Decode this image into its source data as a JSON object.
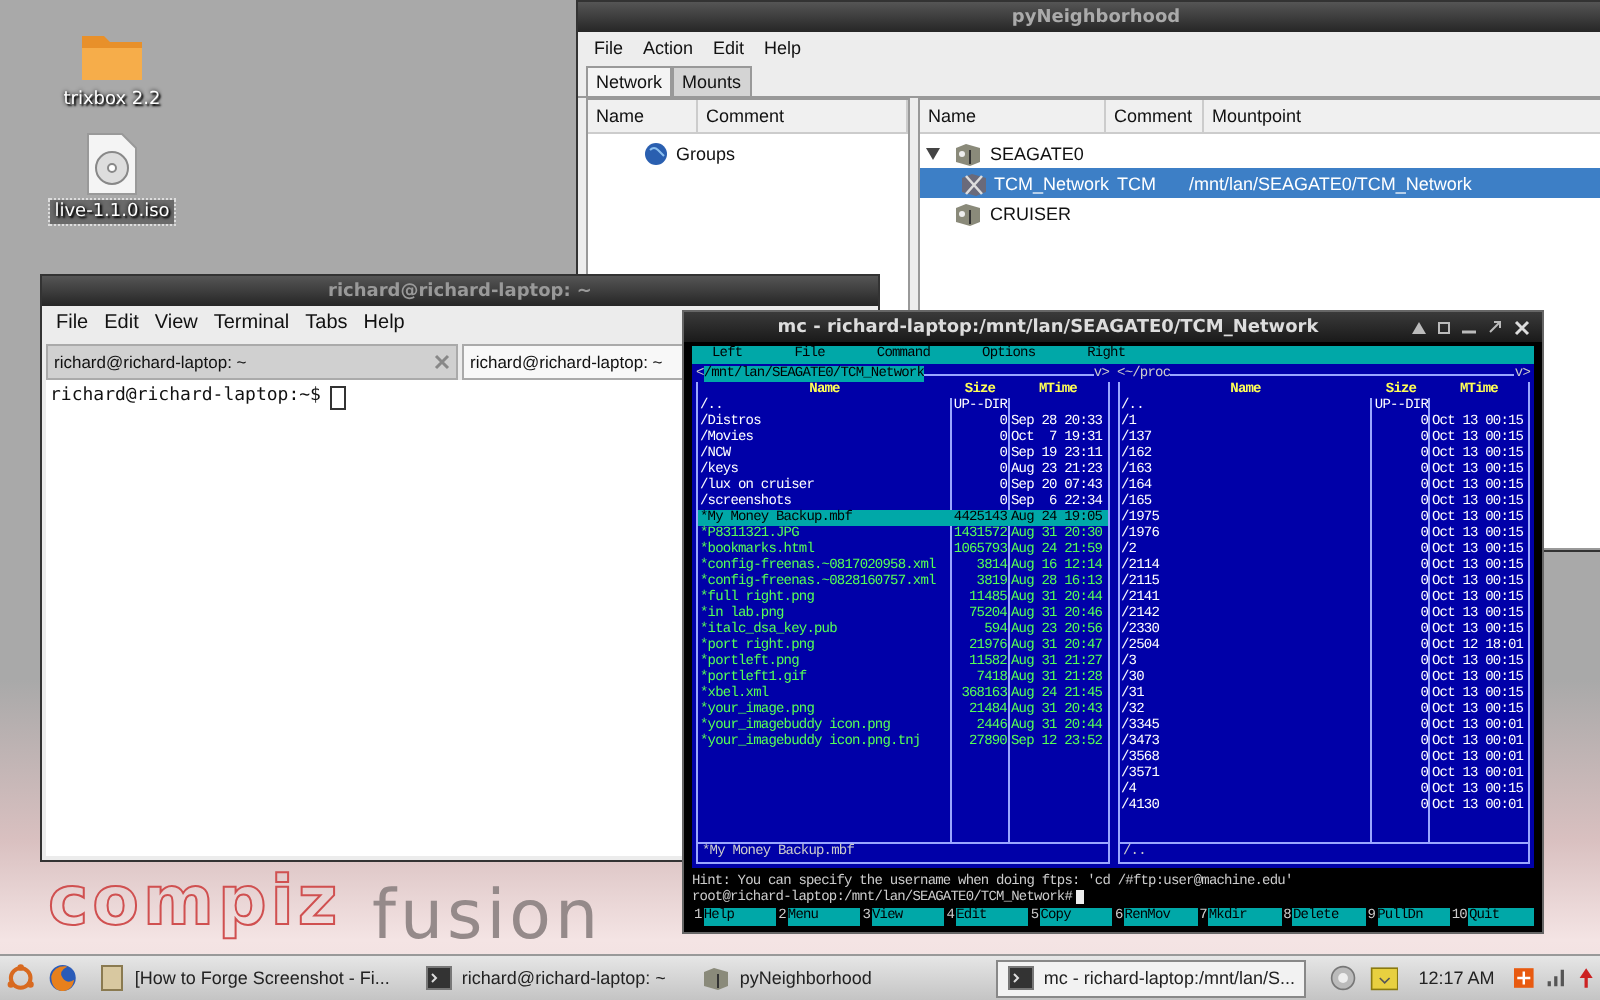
{
  "desktop": {
    "icons": [
      {
        "label": "trixbox 2.2",
        "kind": "folder",
        "selected": false
      },
      {
        "label": "live-1.1.0.iso",
        "kind": "disc",
        "selected": true
      }
    ],
    "wallpaper_logo": [
      "compiz",
      "fusion"
    ]
  },
  "pyneighborhood": {
    "title": "pyNeighborhood",
    "menu": [
      "File",
      "Action",
      "Edit",
      "Help"
    ],
    "tabs": [
      {
        "label": "Network",
        "selected": true
      },
      {
        "label": "Mounts",
        "selected": false
      }
    ],
    "groups_pane": {
      "columns": [
        "Name",
        "Comment"
      ],
      "items": [
        {
          "name": "Groups",
          "selected": false
        }
      ]
    },
    "shares_pane": {
      "columns": [
        "Name",
        "Comment",
        "Mountpoint"
      ],
      "tree": [
        {
          "name": "SEAGATE0",
          "selected": false,
          "expanded": true,
          "children": [
            {
              "name": "TCM_Network",
              "comment": "TCM",
              "mountpoint": "/mnt/lan/SEAGATE0/TCM_Network",
              "selected": true
            }
          ]
        },
        {
          "name": "CRUISER",
          "selected": false
        }
      ]
    }
  },
  "terminal": {
    "title": "richard@richard-laptop: ~",
    "menu": [
      "File",
      "Edit",
      "View",
      "Terminal",
      "Tabs",
      "Help"
    ],
    "tabs": [
      {
        "label": "richard@richard-laptop: ~",
        "selected": false
      },
      {
        "label": "richard@richard-laptop: ~",
        "selected": true
      }
    ],
    "prompt": "richard@richard-laptop:~$"
  },
  "mc": {
    "title": "mc - richard-laptop:/mnt/lan/SEAGATE0/TCM_Network",
    "menu": [
      "Left",
      "File",
      "Command",
      "Options",
      "Right"
    ],
    "panels": [
      {
        "active": true,
        "prev": "<",
        "path": "/mnt/lan/SEAGATE0/TCM_Network",
        "next": "v>",
        "columns": [
          "Name",
          "Size",
          "MTime"
        ],
        "rows": [
          {
            "name": "/..",
            "size": "UP--DIR",
            "kind": "dir",
            "selected": false
          },
          {
            "name": "/Distros",
            "size": "0",
            "mtime": "Sep 28 20:33",
            "kind": "dir",
            "selected": false
          },
          {
            "name": "/Movies",
            "size": "0",
            "mtime": "Oct  7 19:31",
            "kind": "dir",
            "selected": false
          },
          {
            "name": "/NCW",
            "size": "0",
            "mtime": "Sep 19 23:11",
            "kind": "dir",
            "selected": false
          },
          {
            "name": "/keys",
            "size": "0",
            "mtime": "Aug 23 21:23",
            "kind": "dir",
            "selected": false
          },
          {
            "name": "/lux on cruiser",
            "size": "0",
            "mtime": "Sep 20 07:43",
            "kind": "dir",
            "selected": false
          },
          {
            "name": "/screenshots",
            "size": "0",
            "mtime": "Sep  6 22:34",
            "kind": "dir",
            "selected": false
          },
          {
            "name": "*My Money Backup.mbf",
            "size": "4425143",
            "mtime": "Aug 24 19:05",
            "kind": "exec",
            "selected": true
          },
          {
            "name": "*P8311321.JPG",
            "size": "1431572",
            "mtime": "Aug 31 20:30",
            "kind": "exec",
            "selected": false
          },
          {
            "name": "*bookmarks.html",
            "size": "1065793",
            "mtime": "Aug 24 21:59",
            "kind": "exec",
            "selected": false
          },
          {
            "name": "*config-freenas.~0817020958.xml",
            "size": "3814",
            "mtime": "Aug 16 12:14",
            "kind": "exec",
            "selected": false
          },
          {
            "name": "*config-freenas.~0828160757.xml",
            "size": "3819",
            "mtime": "Aug 28 16:13",
            "kind": "exec",
            "selected": false
          },
          {
            "name": "*full right.png",
            "size": "11485",
            "mtime": "Aug 31 20:44",
            "kind": "exec",
            "selected": false
          },
          {
            "name": "*in lab.png",
            "size": "75204",
            "mtime": "Aug 31 20:46",
            "kind": "exec",
            "selected": false
          },
          {
            "name": "*italc_dsa_key.pub",
            "size": "594",
            "mtime": "Aug 23 20:56",
            "kind": "exec",
            "selected": false
          },
          {
            "name": "*port right.png",
            "size": "21976",
            "mtime": "Aug 31 20:47",
            "kind": "exec",
            "selected": false
          },
          {
            "name": "*portleft.png",
            "size": "11582",
            "mtime": "Aug 31 21:27",
            "kind": "exec",
            "selected": false
          },
          {
            "name": "*portleft1.gif",
            "size": "7418",
            "mtime": "Aug 31 21:28",
            "kind": "exec",
            "selected": false
          },
          {
            "name": "*xbel.xml",
            "size": "368163",
            "mtime": "Aug 24 21:45",
            "kind": "exec",
            "selected": false
          },
          {
            "name": "*your_image.png",
            "size": "21484",
            "mtime": "Aug 31 20:43",
            "kind": "exec",
            "selected": false
          },
          {
            "name": "*your_imagebuddy icon.png",
            "size": "2446",
            "mtime": "Aug 31 20:44",
            "kind": "exec",
            "selected": false
          },
          {
            "name": "*your_imagebuddy icon.png.tnj",
            "size": "27890",
            "mtime": "Sep 12 23:52",
            "kind": "exec",
            "selected": false
          }
        ],
        "status": "*My Money Backup.mbf"
      },
      {
        "active": false,
        "prev": "<",
        "path": "~/proc",
        "next": "v>",
        "columns": [
          "Name",
          "Size",
          "MTime"
        ],
        "rows": [
          {
            "name": "/..",
            "size": "UP--DIR",
            "kind": "dir",
            "selected": false
          },
          {
            "name": "/1",
            "size": "0",
            "mtime": "Oct 13 00:15",
            "kind": "dir",
            "selected": false
          },
          {
            "name": "/137",
            "size": "0",
            "mtime": "Oct 13 00:15",
            "kind": "dir",
            "selected": false
          },
          {
            "name": "/162",
            "size": "0",
            "mtime": "Oct 13 00:15",
            "kind": "dir",
            "selected": false
          },
          {
            "name": "/163",
            "size": "0",
            "mtime": "Oct 13 00:15",
            "kind": "dir",
            "selected": false
          },
          {
            "name": "/164",
            "size": "0",
            "mtime": "Oct 13 00:15",
            "kind": "dir",
            "selected": false
          },
          {
            "name": "/165",
            "size": "0",
            "mtime": "Oct 13 00:15",
            "kind": "dir",
            "selected": false
          },
          {
            "name": "/1975",
            "size": "0",
            "mtime": "Oct 13 00:15",
            "kind": "dir",
            "selected": false
          },
          {
            "name": "/1976",
            "size": "0",
            "mtime": "Oct 13 00:15",
            "kind": "dir",
            "selected": false
          },
          {
            "name": "/2",
            "size": "0",
            "mtime": "Oct 13 00:15",
            "kind": "dir",
            "selected": false
          },
          {
            "name": "/2114",
            "size": "0",
            "mtime": "Oct 13 00:15",
            "kind": "dir",
            "selected": false
          },
          {
            "name": "/2115",
            "size": "0",
            "mtime": "Oct 13 00:15",
            "kind": "dir",
            "selected": false
          },
          {
            "name": "/2141",
            "size": "0",
            "mtime": "Oct 13 00:15",
            "kind": "dir",
            "selected": false
          },
          {
            "name": "/2142",
            "size": "0",
            "mtime": "Oct 13 00:15",
            "kind": "dir",
            "selected": false
          },
          {
            "name": "/2330",
            "size": "0",
            "mtime": "Oct 13 00:15",
            "kind": "dir",
            "selected": false
          },
          {
            "name": "/2504",
            "size": "0",
            "mtime": "Oct 12 18:01",
            "kind": "dir",
            "selected": false
          },
          {
            "name": "/3",
            "size": "0",
            "mtime": "Oct 13 00:15",
            "kind": "dir",
            "selected": false
          },
          {
            "name": "/30",
            "size": "0",
            "mtime": "Oct 13 00:15",
            "kind": "dir",
            "selected": false
          },
          {
            "name": "/31",
            "size": "0",
            "mtime": "Oct 13 00:15",
            "kind": "dir",
            "selected": false
          },
          {
            "name": "/32",
            "size": "0",
            "mtime": "Oct 13 00:15",
            "kind": "dir",
            "selected": false
          },
          {
            "name": "/3345",
            "size": "0",
            "mtime": "Oct 13 00:01",
            "kind": "dir",
            "selected": false
          },
          {
            "name": "/3473",
            "size": "0",
            "mtime": "Oct 13 00:01",
            "kind": "dir",
            "selected": false
          },
          {
            "name": "/3568",
            "size": "0",
            "mtime": "Oct 13 00:01",
            "kind": "dir",
            "selected": false
          },
          {
            "name": "/3571",
            "size": "0",
            "mtime": "Oct 13 00:01",
            "kind": "dir",
            "selected": false
          },
          {
            "name": "/4",
            "size": "0",
            "mtime": "Oct 13 00:15",
            "kind": "dir",
            "selected": false
          },
          {
            "name": "/4130",
            "size": "0",
            "mtime": "Oct 13 00:01",
            "kind": "dir",
            "selected": false
          }
        ],
        "status": "/.."
      }
    ],
    "hint": "Hint: You can specify the username when doing ftps: 'cd /#ftp:user@machine.edu'",
    "prompt": "root@richard-laptop:/mnt/lan/SEAGATE0/TCM_Network#",
    "function_keys": [
      {
        "number": "1",
        "label": "Help"
      },
      {
        "number": "2",
        "label": "Menu"
      },
      {
        "number": "3",
        "label": "View"
      },
      {
        "number": "4",
        "label": "Edit"
      },
      {
        "number": "5",
        "label": "Copy"
      },
      {
        "number": "6",
        "label": "RenMov"
      },
      {
        "number": "7",
        "label": "Mkdir"
      },
      {
        "number": "8",
        "label": "Delete"
      },
      {
        "number": "9",
        "label": "PullDn"
      },
      {
        "number": "10",
        "label": "Quit"
      }
    ]
  },
  "taskbar": {
    "tasks": [
      {
        "label": "[How to Forge Screenshot - Fi...",
        "kind": "page",
        "selected": false
      },
      {
        "label": "richard@richard-laptop: ~",
        "kind": "terminal",
        "selected": false
      },
      {
        "label": "pyNeighborhood",
        "kind": "network",
        "selected": false
      },
      {
        "label": "mc - richard-laptop:/mnt/lan/S...",
        "kind": "terminal",
        "selected": true
      }
    ],
    "clock": "12:17 AM"
  }
}
